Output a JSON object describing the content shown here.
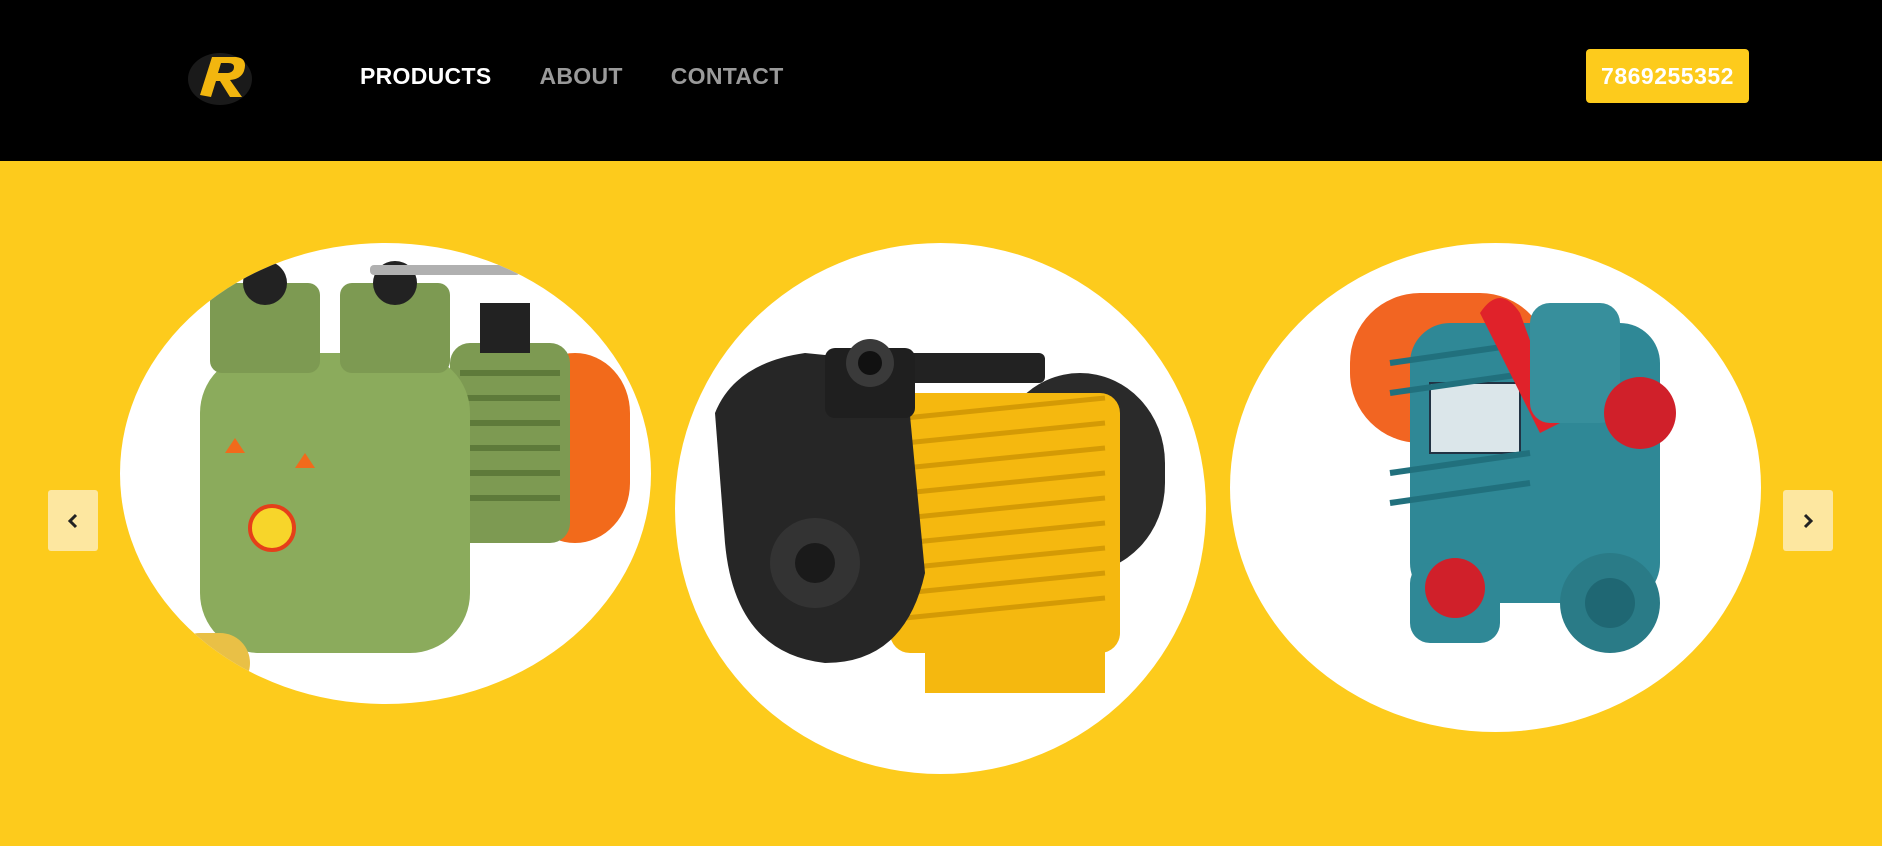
{
  "header": {
    "logo_letter": "R",
    "nav": [
      {
        "label": "PRODUCTS"
      },
      {
        "label": "ABOUT"
      },
      {
        "label": "CONTACT"
      }
    ],
    "phone": "7869255352"
  },
  "carousel": {
    "slides": [
      {
        "product": "green-water-pump",
        "icon": "pump-image"
      },
      {
        "product": "yellow-black-water-pump",
        "icon": "pump-image"
      },
      {
        "product": "teal-water-pump",
        "icon": "pump-image"
      }
    ],
    "prev_icon": "chevron-left-icon",
    "next_icon": "chevron-right-icon"
  },
  "colors": {
    "header_bg": "#000000",
    "accent": "#fdcb1c",
    "nav_active": "#ffffff",
    "nav_inactive": "#9a9a9a"
  }
}
